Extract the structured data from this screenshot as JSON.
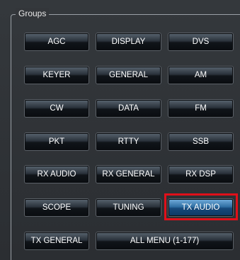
{
  "group": {
    "title": "Groups"
  },
  "buttons": [
    "AGC",
    "DISPLAY",
    "DVS",
    "KEYER",
    "GENERAL",
    "AM",
    "CW",
    "DATA",
    "FM",
    "PKT",
    "RTTY",
    "SSB",
    "RX AUDIO",
    "RX GENERAL",
    "RX DSP",
    "SCOPE",
    "TUNING",
    "TX AUDIO",
    "TX GENERAL",
    "ALL MENU (1-177)"
  ],
  "selected": "TX AUDIO",
  "colors": {
    "highlight_box": "#e0101a",
    "active_button": "#2f6fa3"
  }
}
